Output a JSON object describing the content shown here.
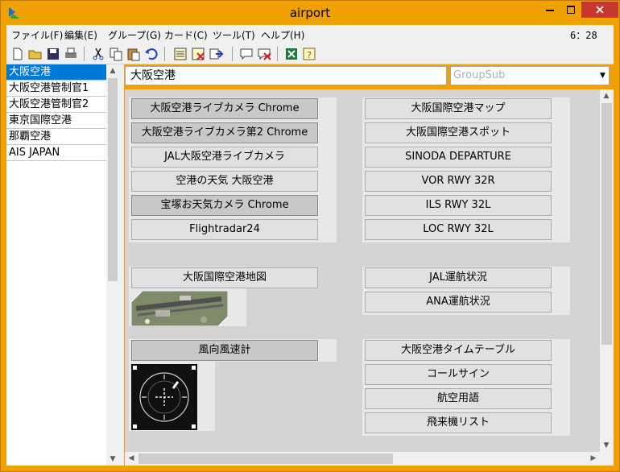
{
  "window": {
    "title": "airport",
    "clock": "6：28",
    "accent": "#f0a000"
  },
  "menu": [
    {
      "label": "ファイル(F)"
    },
    {
      "label": "編集(E)"
    },
    {
      "label": "グループ(G)"
    },
    {
      "label": "カード(C)"
    },
    {
      "label": "ツール(T)"
    },
    {
      "label": "ヘルプ(H)"
    }
  ],
  "toolbar": [
    {
      "icon": "new-file-icon"
    },
    {
      "icon": "open-folder-icon"
    },
    {
      "icon": "save-icon"
    },
    {
      "icon": "print-icon"
    },
    {
      "icon": "cut-icon"
    },
    {
      "icon": "copy-icon"
    },
    {
      "icon": "paste-icon"
    },
    {
      "icon": "undo-icon"
    },
    {
      "icon": "list-icon"
    },
    {
      "icon": "delete-card-icon"
    },
    {
      "icon": "export-icon"
    },
    {
      "icon": "comment-icon"
    },
    {
      "icon": "delete-comment-icon"
    },
    {
      "icon": "excel-icon"
    },
    {
      "icon": "help-icon"
    }
  ],
  "groups": [
    {
      "label": "大阪空港",
      "selected": true
    },
    {
      "label": "大阪空港管制官1",
      "selected": false
    },
    {
      "label": "大阪空港管制官2",
      "selected": false
    },
    {
      "label": "東京国際空港",
      "selected": false
    },
    {
      "label": "那覇空港",
      "selected": false
    },
    {
      "label": "AIS JAPAN",
      "selected": false
    }
  ],
  "header": {
    "group_title": "大阪空港",
    "groupsub_placeholder": "GroupSub"
  },
  "cards": {
    "panel1": [
      {
        "label": "大阪空港ライブカメラ Chrome",
        "style": "dark"
      },
      {
        "label": "大阪空港ライブカメラ第2 Chrome",
        "style": "dark"
      },
      {
        "label": "JAL大阪空港ライブカメラ",
        "style": "normal"
      },
      {
        "label": "空港の天気 大阪空港",
        "style": "normal"
      },
      {
        "label": "宝塚お天気カメラ Chrome",
        "style": "dark"
      },
      {
        "label": "Flightradar24",
        "style": "normal"
      }
    ],
    "panel2": [
      {
        "label": "大阪国際空港マップ"
      },
      {
        "label": "大阪国際空港スポット"
      },
      {
        "label": "SINODA DEPARTURE"
      },
      {
        "label": "VOR RWY 32R"
      },
      {
        "label": "ILS RWY 32L"
      },
      {
        "label": "LOC RWY 32L"
      }
    ],
    "panel3": [
      {
        "label": "大阪国際空港地図"
      }
    ],
    "panel4": [
      {
        "label": "JAL運航状況"
      },
      {
        "label": "ANA運航状況"
      }
    ],
    "panel5": [
      {
        "label": "風向風速計",
        "style": "dark"
      }
    ],
    "panel6": [
      {
        "label": "大阪空港タイムテーブル"
      },
      {
        "label": "コールサイン"
      },
      {
        "label": "航空用語"
      },
      {
        "label": "飛来機リスト"
      }
    ]
  }
}
